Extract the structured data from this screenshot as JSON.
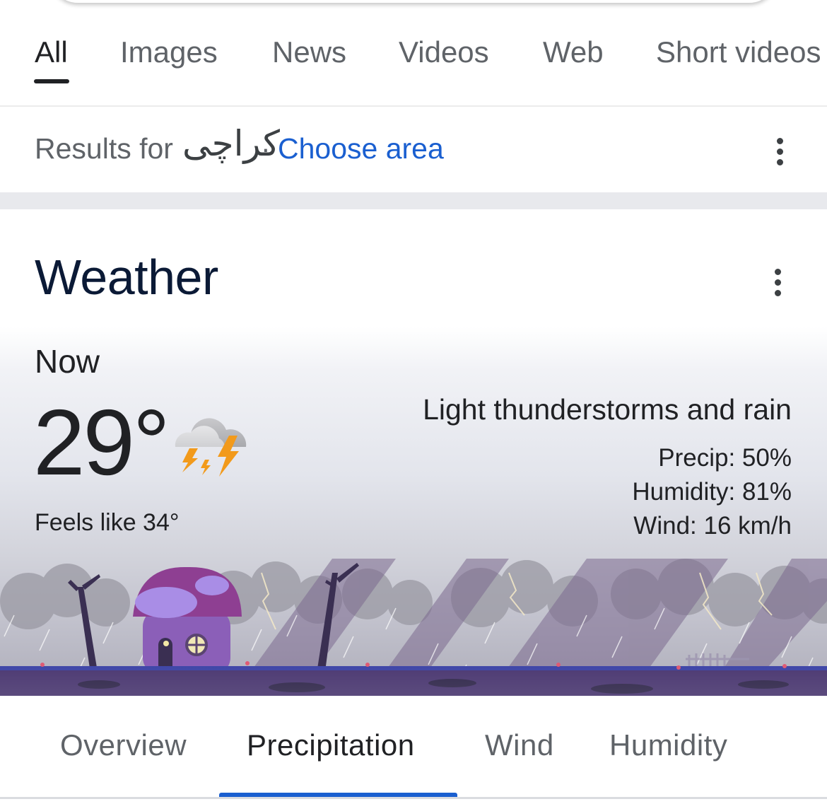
{
  "tabs": [
    {
      "label": "All",
      "active": true
    },
    {
      "label": "Images",
      "active": false
    },
    {
      "label": "News",
      "active": false
    },
    {
      "label": "Videos",
      "active": false
    },
    {
      "label": "Web",
      "active": false
    },
    {
      "label": "Short videos",
      "active": false
    }
  ],
  "results": {
    "prefix": "Results for",
    "location": "کراچی",
    "separator": "·",
    "choose_area": "Choose area"
  },
  "weather": {
    "title": "Weather",
    "now_label": "Now",
    "temperature": "29°",
    "feels_like": "Feels like 34°",
    "condition": "Light thunderstorms and rain",
    "precip": "Precip: 50%",
    "humidity": "Humidity: 81%",
    "wind": "Wind: 16 km/h",
    "icon": "thunderstorm-cloud-icon"
  },
  "weather_tabs": [
    {
      "label": "Overview",
      "active": false
    },
    {
      "label": "Precipitation",
      "active": true
    },
    {
      "label": "Wind",
      "active": false
    },
    {
      "label": "Humidity",
      "active": false
    }
  ],
  "colors": {
    "link": "#1a5fd0",
    "title": "#0b1a36",
    "active_tab_underline": "#1a5fd0",
    "lightning": "#f29a1b"
  }
}
